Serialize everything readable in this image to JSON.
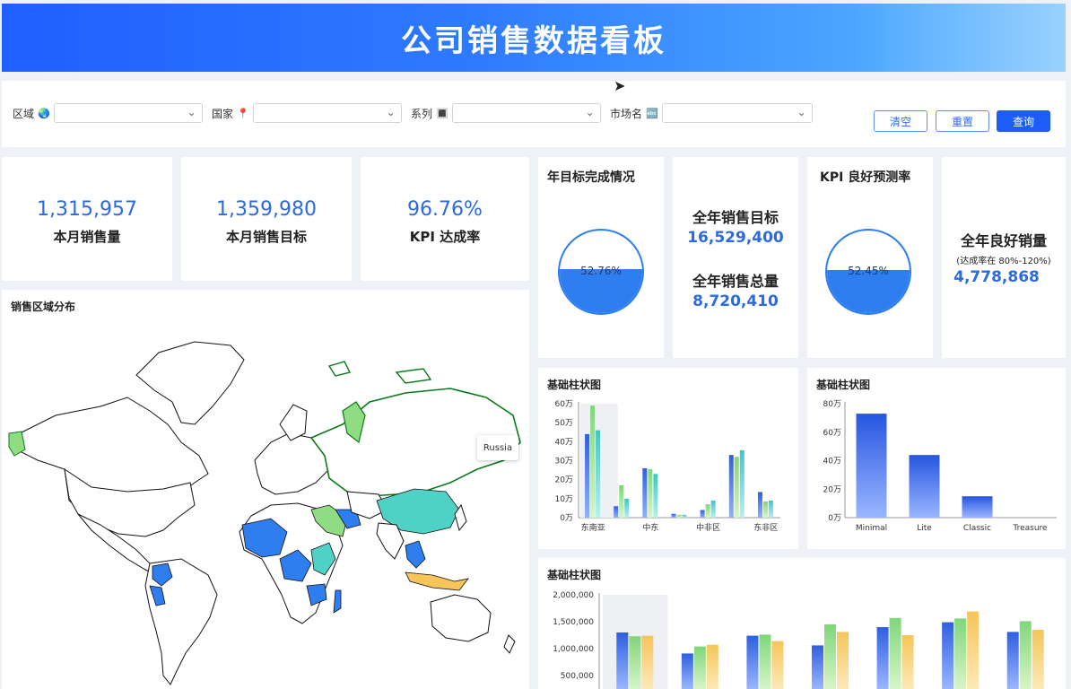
{
  "header": {
    "title": "公司销售数据看板"
  },
  "filters": [
    {
      "label": "区域",
      "icon": "🌏",
      "value": ""
    },
    {
      "label": "国家",
      "icon": "📍",
      "value": ""
    },
    {
      "label": "系列",
      "icon": "🔳",
      "value": ""
    },
    {
      "label": "市场名",
      "icon": "🔤",
      "value": ""
    }
  ],
  "buttons": {
    "clear": "清空",
    "reset": "重置",
    "query": "查询"
  },
  "kpis": [
    {
      "value": "1,315,957",
      "label": "本月销售量"
    },
    {
      "value": "1,359,980",
      "label": "本月销售目标"
    },
    {
      "value": "96.76%",
      "label": "KPI 达成率"
    }
  ],
  "annual": {
    "title": "年目标完成情况",
    "percent_text": "52.76%",
    "percent": 0.5276,
    "target_label": "全年销售目标",
    "target_value": "16,529,400",
    "total_label": "全年销售总量",
    "total_value": "8,720,410"
  },
  "kpi_forecast": {
    "title": "KPI 良好预测率",
    "percent_text": "52.45%",
    "percent": 0.5245,
    "good_label": "全年良好销量",
    "good_note": "(达成率在 80%-120%)",
    "good_value": "4,778,868"
  },
  "map": {
    "title": "销售区域分布",
    "tooltip": "Russia"
  },
  "colors": {
    "primary": "#1e5ef6",
    "blue": "#3f6fe8",
    "green": "#8fdc82",
    "teal": "#4fd1c5",
    "yellow": "#f5c55a"
  },
  "chart_data": [
    {
      "type": "bar",
      "title": "基础柱状图",
      "categories": [
        "东南亚",
        "中东",
        "中非区",
        "东非区"
      ],
      "ytick_labels": [
        "0万",
        "10万",
        "20万",
        "30万",
        "40万",
        "50万",
        "60万"
      ],
      "ylim": [
        0,
        600000
      ],
      "groups": [
        {
          "category": "东南亚",
          "values": [
            440000,
            590000,
            460000
          ]
        },
        {
          "category": "",
          "values": [
            60000,
            170000,
            100000
          ]
        },
        {
          "category": "中东",
          "values": [
            260000,
            255000,
            230000
          ]
        },
        {
          "category": "",
          "values": [
            20000,
            15000,
            15000
          ]
        },
        {
          "category": "中非区",
          "values": [
            40000,
            70000,
            90000
          ]
        },
        {
          "category": "",
          "values": [
            330000,
            320000,
            355000
          ]
        },
        {
          "category": "东非区",
          "values": [
            135000,
            85000,
            90000
          ]
        }
      ]
    },
    {
      "type": "bar",
      "title": "基础柱状图",
      "categories": [
        "Minimal",
        "Lite",
        "Classic",
        "Treasure"
      ],
      "values": [
        730000,
        440000,
        150000,
        0
      ],
      "ytick_labels": [
        "0万",
        "20万",
        "40万",
        "60万",
        "80万"
      ],
      "ylim": [
        0,
        800000
      ]
    },
    {
      "type": "bar",
      "title": "基础柱状图",
      "categories": [
        "",
        "",
        "",
        "",
        "",
        "",
        "",
        ""
      ],
      "series": [
        {
          "values": [
            1300000,
            910000,
            1240000,
            1060000,
            1400000,
            1490000,
            1310000
          ]
        },
        {
          "values": [
            1230000,
            1040000,
            1260000,
            1450000,
            1570000,
            1560000,
            1510000
          ]
        },
        {
          "values": [
            1240000,
            1070000,
            1140000,
            1310000,
            1250000,
            1690000,
            1350000
          ]
        }
      ],
      "ytick_labels": [
        "500,000",
        "1,000,000",
        "1,500,000",
        "2,000,000"
      ],
      "ylim": [
        0,
        2000000
      ]
    }
  ]
}
